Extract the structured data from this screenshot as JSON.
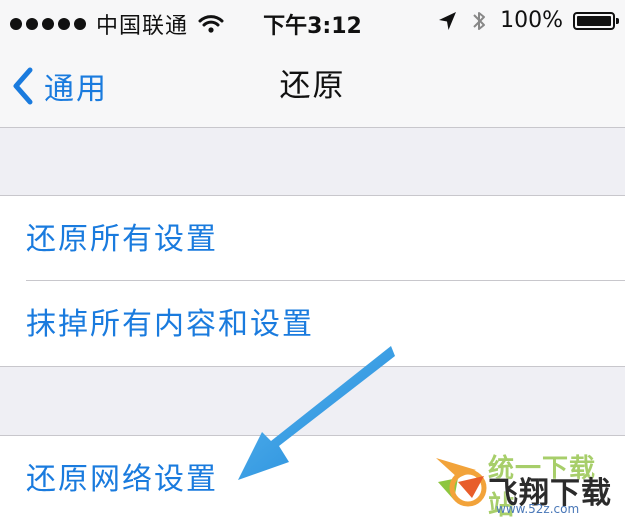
{
  "status_bar": {
    "carrier": "中国联通",
    "time": "下午3:12",
    "battery": "100%",
    "icons": [
      "signal-dots",
      "wifi-icon",
      "location-icon",
      "bluetooth-icon",
      "battery-icon"
    ]
  },
  "nav": {
    "back_label": "通用",
    "title": "还原"
  },
  "groups": [
    {
      "items": [
        {
          "label": "还原所有设置"
        },
        {
          "label": "抹掉所有内容和设置"
        }
      ]
    },
    {
      "items": [
        {
          "label": "还原网络设置"
        }
      ]
    }
  ],
  "watermark": {
    "top": "统一下载站",
    "main": "飞翔下载",
    "url": "www.52z.com"
  },
  "colors": {
    "accent": "#1a7bde",
    "background": "#efeff4",
    "arrow": "#2f9be6",
    "text": "#111111"
  }
}
